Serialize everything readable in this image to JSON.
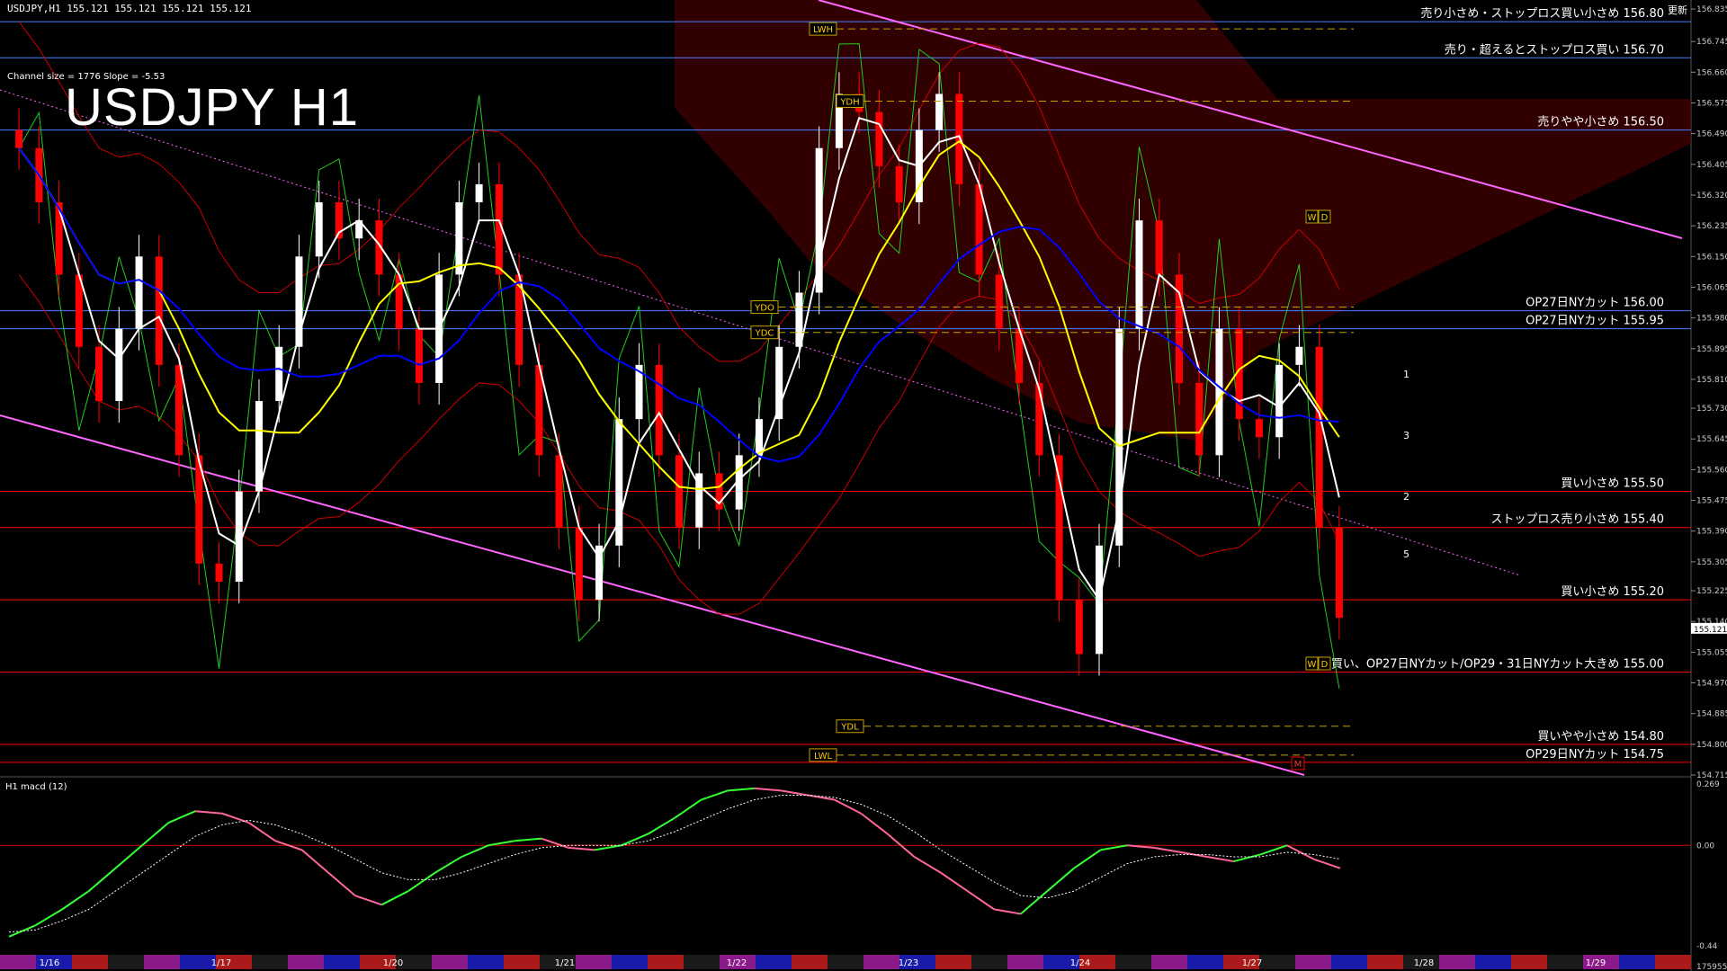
{
  "header": {
    "symbol_info": "USDJPY,H1  155.121 155.121 155.121 155.121",
    "chart_title": "USDJPY H1",
    "channel_info": "Channel size = 1776 Slope = -5.53",
    "macd_title": "H1  macd (12)",
    "top_right": "更新"
  },
  "colors": {
    "bull": "#ffffff",
    "bear": "#ff0000",
    "ma_fast": "#ffffff",
    "ma_mid": "#ffff00",
    "ma_slow": "#0000ff",
    "ichimoku_cloud": "#ff2020",
    "trend": "#ff66ff",
    "macd_main": "#33ff33",
    "macd_neg": "#ff6699",
    "macd_signal": "#ffffff"
  },
  "chart_data": {
    "type": "candlestick",
    "symbol": "USDJPY",
    "timeframe": "H1",
    "ylim": [
      154.715,
      156.835
    ],
    "y_ticks": [
      "156.835",
      "156.745",
      "156.660",
      "156.575",
      "156.490",
      "156.405",
      "156.320",
      "156.235",
      "156.150",
      "156.065",
      "155.980",
      "155.895",
      "155.810",
      "155.730",
      "155.645",
      "155.560",
      "155.475",
      "155.390",
      "155.305",
      "155.225",
      "155.140",
      "155.055",
      "154.970",
      "154.885",
      "154.800",
      "154.715"
    ],
    "price_label": "155.121",
    "x_ticks": [
      "1/16",
      "1/17",
      "1/20",
      "1/21",
      "1/22",
      "1/23",
      "1/24",
      "1/27",
      "1/28",
      "1/29"
    ],
    "levels": [
      {
        "price": 156.8,
        "label": "売り小さめ・ストップロス買い小さめ 156.80",
        "color": "#4a7fff"
      },
      {
        "price": 156.7,
        "label": "売り・超えるとストップロス買い 156.70",
        "color": "#4a7fff"
      },
      {
        "price": 156.5,
        "label": "売りやや小さめ 156.50",
        "color": "#4a7fff"
      },
      {
        "price": 156.0,
        "label": "OP27日NYカット 156.00",
        "color": "#4a7fff"
      },
      {
        "price": 155.95,
        "label": "OP27日NYカット 155.95",
        "color": "#4a7fff"
      },
      {
        "price": 155.5,
        "label": "買い小さめ 155.50",
        "color": "#ff0000"
      },
      {
        "price": 155.4,
        "label": "ストップロス売り小さめ 155.40",
        "color": "#ff0000"
      },
      {
        "price": 155.2,
        "label": "買い小さめ 155.20",
        "color": "#ff0000"
      },
      {
        "price": 155.0,
        "label": "買い、OP27日NYカット/OP29・31日NYカット大きめ 155.00",
        "color": "#ff0000"
      },
      {
        "price": 154.8,
        "label": "買いやや小さめ 154.80",
        "color": "#ff0000"
      },
      {
        "price": 154.75,
        "label": "OP29日NYカット 154.75",
        "color": "#ff0000"
      }
    ],
    "markers": [
      {
        "label": "LWH",
        "price": 156.78
      },
      {
        "label": "YDH",
        "price": 156.58
      },
      {
        "label": "YDO",
        "price": 156.01
      },
      {
        "label": "YDC",
        "price": 155.94
      },
      {
        "label": "YDL",
        "price": 154.85
      },
      {
        "label": "LWL",
        "price": 154.77
      }
    ],
    "wave_labels": [
      "1",
      "3",
      "2",
      "5"
    ],
    "wd_labels": [
      "W",
      "D"
    ],
    "m_label": "M",
    "series": [
      {
        "name": "close",
        "values": [
          156.45,
          156.3,
          156.1,
          155.9,
          155.75,
          155.95,
          156.15,
          155.85,
          155.6,
          155.3,
          155.25,
          155.5,
          155.75,
          155.9,
          156.15,
          156.3,
          156.2,
          156.25,
          156.1,
          155.95,
          155.8,
          156.1,
          156.3,
          156.35,
          156.1,
          155.85,
          155.6,
          155.4,
          155.2,
          155.35,
          155.7,
          155.85,
          155.6,
          155.4,
          155.55,
          155.45,
          155.6,
          155.7,
          155.9,
          156.05,
          156.45,
          156.6,
          156.55,
          156.4,
          156.3,
          156.5,
          156.6,
          156.35,
          156.1,
          155.95,
          155.8,
          155.6,
          155.2,
          155.05,
          155.35,
          155.95,
          156.25,
          156.1,
          155.8,
          155.6,
          155.95,
          155.7,
          155.65,
          155.85,
          155.9,
          155.4,
          155.15
        ]
      }
    ],
    "macd_ylim": [
      -0.44,
      0.269
    ],
    "macd_ticks": [
      "0.269",
      "0.00",
      "-0.44"
    ],
    "macd_bottom_label": "175955",
    "macd_main": [
      -0.4,
      -0.35,
      -0.28,
      -0.2,
      -0.1,
      0.0,
      0.1,
      0.15,
      0.14,
      0.1,
      0.02,
      -0.02,
      -0.12,
      -0.22,
      -0.26,
      -0.2,
      -0.12,
      -0.05,
      0.0,
      0.02,
      0.03,
      -0.01,
      -0.02,
      0.0,
      0.05,
      0.12,
      0.2,
      0.24,
      0.25,
      0.24,
      0.22,
      0.2,
      0.14,
      0.05,
      -0.05,
      -0.12,
      -0.2,
      -0.28,
      -0.3,
      -0.2,
      -0.1,
      -0.02,
      0.0,
      -0.01,
      -0.03,
      -0.05,
      -0.07,
      -0.04,
      0.0,
      -0.06,
      -0.1
    ],
    "macd_signal": [
      -0.38,
      -0.37,
      -0.33,
      -0.28,
      -0.2,
      -0.12,
      -0.04,
      0.04,
      0.09,
      0.11,
      0.09,
      0.05,
      0.0,
      -0.06,
      -0.12,
      -0.15,
      -0.15,
      -0.12,
      -0.08,
      -0.04,
      -0.01,
      0.0,
      0.0,
      0.0,
      0.02,
      0.06,
      0.11,
      0.16,
      0.2,
      0.22,
      0.22,
      0.21,
      0.18,
      0.13,
      0.06,
      -0.02,
      -0.09,
      -0.16,
      -0.22,
      -0.23,
      -0.2,
      -0.14,
      -0.08,
      -0.05,
      -0.04,
      -0.04,
      -0.05,
      -0.05,
      -0.03,
      -0.04,
      -0.06
    ]
  }
}
